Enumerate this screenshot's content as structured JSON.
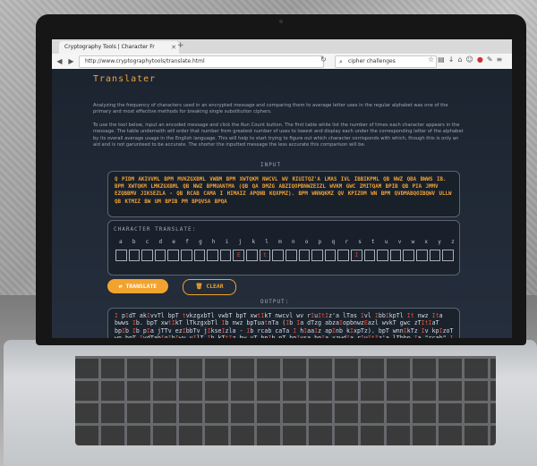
{
  "browser": {
    "tab_title": "Cryptography Tools | Character Fr",
    "url": "http://www.cryptographytools/translate.html",
    "search_text": "cipher challenges"
  },
  "page": {
    "title": "Translater",
    "intro": "Analyzing the frequency of characters used in an encrypted message and comparing them to average letter uses in the regular alphabet was one of the primary and most effective methods for breaking single substitution ciphers.",
    "instructions": "To use the tool below, input an encoded message and click the Run Count button. The first table while list the number of times each character appears in the message. The table underneith will order that number from greatest number of uses to lowest and display each under the corresponding letter of the alphabet by its overall average usage in the English language. This will help to start trying to figure out which character corrisponds with which, though this is only an aid and is not garunteed to be accurate. The shorter the inputted message the less accurate this comparison will be.",
    "input_label": "INPUT",
    "input_text": "Q PIDM AKIVVML BPM MVKZGXBML VWBM BPM XWTQKM NWCVL WV RIUITQZ'A LMAS IVL IBBIKPML QB NWZ QBA BWWS IB. BPM XWTQKM LMKZGXBML QB NWZ BPMUANTMA (QB QA DMZG ABZIQOPBNWZEIZL WVKM GWC ZMITQAM BPIB QB PIA JMMV EZQBBMV JIKSEZLA - QB RCAB CAMA I HIMAIZ APQNB KQXPMZ). BPM WNNQKMZ QV KPIZOM WN BPM QVDMABQOIBQWV ULLW QB KTMIZ BW UM BPIB PM BPQVSA BPQA",
    "char_label": "CHARACTER TRANSLATE:",
    "letters": [
      "a",
      "b",
      "c",
      "d",
      "e",
      "f",
      "g",
      "h",
      "i",
      "j",
      "k",
      "l",
      "m",
      "n",
      "o",
      "p",
      "q",
      "r",
      "s",
      "t",
      "u",
      "v",
      "w",
      "x",
      "y",
      "z"
    ],
    "translations": [
      "",
      "",
      "",
      "",
      "",
      "",
      "",
      "",
      "",
      "E",
      "",
      "t",
      "",
      "",
      "",
      "",
      "",
      "",
      "I",
      "",
      "",
      "",
      "",
      "",
      "",
      ""
    ],
    "translate_button": "TRANSLATE",
    "clear_button": "CLEAR",
    "output_label": "OUTPUT:",
    "output_text": "I pIdT akIvvTl bpT tvkzgxbTl vwbT bpT xwtIkT nwcvl wv rIuItIz'a lTas Ivl IbbIkpTl It nwz Ita bwws Ib. bpT xwtIkT lTkzgxbTl Ib nwz bpTuatnTa (Ib Ia dTzg abzaIopbnwzEazl wvkT gwc zTItIaT bpIb Ib pIa jTTv ezIbbTv jIkseIzla - Ib rcab caTa I hIaaIz apInb kIxpTz). bpT wnnIkTz Iv kpIzoT wn bpT IvdTabIoIbIwv uIlT Ib kTtIz bw uT bpIb pT bpIvsa bpIa xzwdIa rIuItIz'a lTbbp Ia \"rcab\" I xIzawvIt bzIokTg, kEzItTaa caTwv bpT ewzl \"rcab\" lTz Iv pT Iz zIopb, jcb I"
  }
}
